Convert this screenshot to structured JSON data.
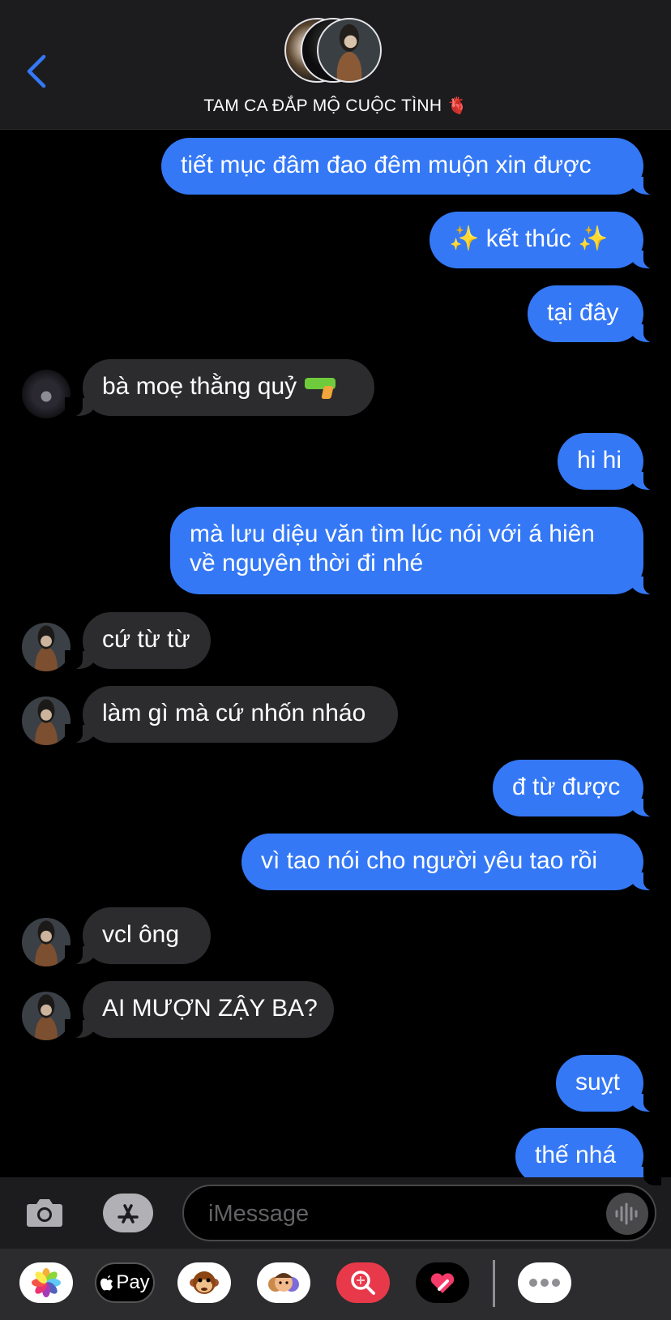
{
  "header": {
    "title": "TAM CA ĐẮP MỘ CUỘC TÌNH",
    "title_emoji": "🫀"
  },
  "messages": [
    {
      "direction": "outgoing",
      "text": "tiết mục đâm đao đêm muộn xin được"
    },
    {
      "direction": "outgoing",
      "text": "✨ kết thúc ✨"
    },
    {
      "direction": "outgoing",
      "text": "tại đây"
    },
    {
      "direction": "incoming",
      "text": "bà moẹ thằng quỷ",
      "emoji": "water-pistol"
    },
    {
      "direction": "outgoing",
      "text": "hi hi"
    },
    {
      "direction": "outgoing",
      "lines": [
        "mà lưu diệu văn tìm lúc nói với á hiên",
        "về nguyên thời đi nhé"
      ]
    },
    {
      "direction": "incoming",
      "text": "cứ từ từ"
    },
    {
      "direction": "incoming",
      "text": "làm gì mà cứ nhốn nháo"
    },
    {
      "direction": "outgoing",
      "text": "đ từ được"
    },
    {
      "direction": "outgoing",
      "text": "vì tao nói cho người yêu tao rồi"
    },
    {
      "direction": "incoming",
      "text": "vcl ông"
    },
    {
      "direction": "incoming",
      "text": "AI MƯỢN ZẬY BA?"
    },
    {
      "direction": "outgoing",
      "text": "suỵt"
    },
    {
      "direction": "outgoing",
      "text": "thế nhá"
    }
  ],
  "composer": {
    "placeholder": "iMessage"
  },
  "app_drawer": {
    "apple_pay_label": "Pay",
    "items": [
      "photos-icon",
      "apple-pay-icon",
      "monkey-emoji-icon",
      "memoji-icon",
      "image-search-icon",
      "digital-touch-icon",
      "more-icon"
    ]
  },
  "colors": {
    "outgoing_bubble": "#3478f6",
    "incoming_bubble": "#2c2c2e",
    "background": "#000000",
    "accent": "#3478f6"
  }
}
